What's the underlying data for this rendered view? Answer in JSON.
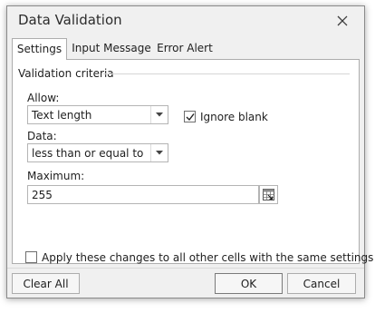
{
  "dialog": {
    "title": "Data Validation"
  },
  "tabs": [
    {
      "label": "Settings",
      "active": true
    },
    {
      "label": "Input Message",
      "active": false
    },
    {
      "label": "Error Alert",
      "active": false
    }
  ],
  "settings": {
    "group_label": "Validation criteria",
    "allow": {
      "label": "Allow:",
      "value": "Text length"
    },
    "ignore_blank": {
      "label": "Ignore blank",
      "checked": true
    },
    "data": {
      "label": "Data:",
      "value": "less than or equal to"
    },
    "maximum": {
      "label": "Maximum:",
      "value": "255"
    },
    "apply_all": {
      "label": "Apply these changes to all other cells with the same settings",
      "checked": false
    }
  },
  "buttons": {
    "clear_all": "Clear All",
    "ok": "OK",
    "cancel": "Cancel"
  }
}
